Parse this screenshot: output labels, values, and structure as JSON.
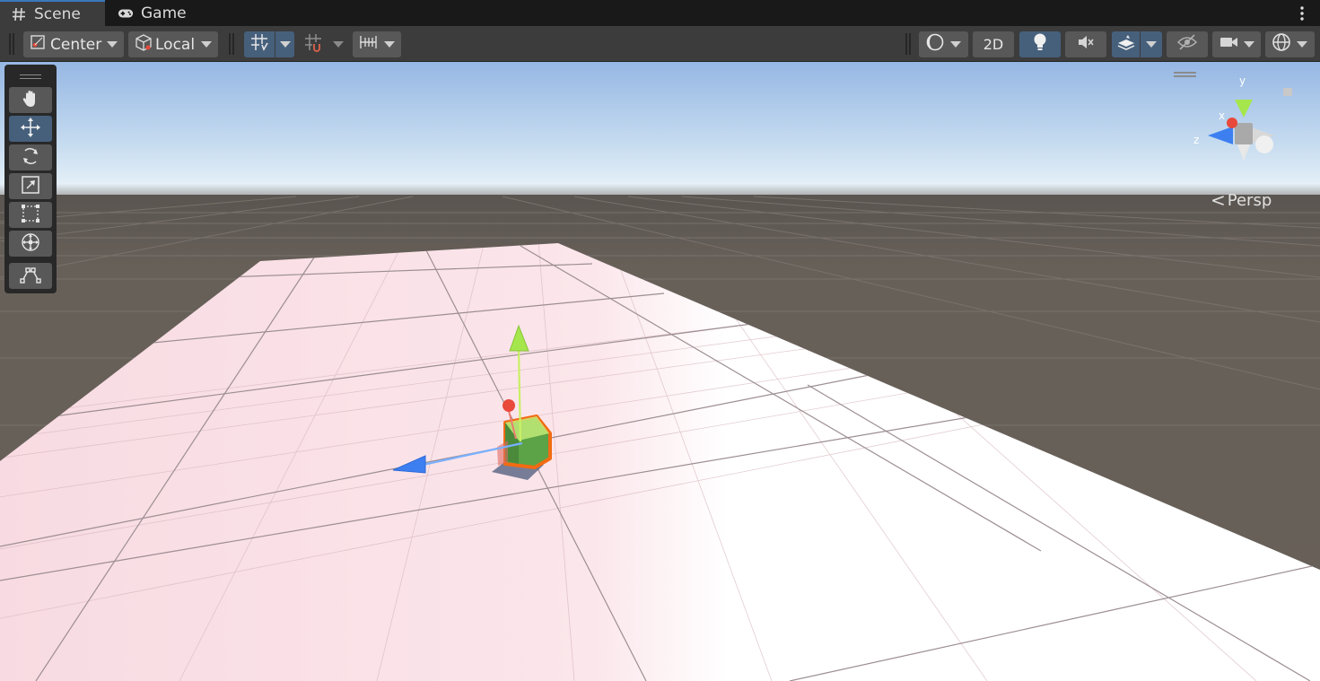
{
  "tabs": [
    {
      "label": "Scene",
      "icon": "hash-icon",
      "active": true
    },
    {
      "label": "Game",
      "icon": "gamepad-icon",
      "active": false
    }
  ],
  "toolbar": {
    "pivot_mode": "Center",
    "pivot_rotation": "Local",
    "mode_2d_label": "2D"
  },
  "tools": [
    {
      "name": "hand-tool",
      "icon": "hand-icon"
    },
    {
      "name": "move-tool",
      "icon": "move-icon",
      "active": true
    },
    {
      "name": "rotate-tool",
      "icon": "rotate-icon"
    },
    {
      "name": "scale-tool",
      "icon": "scale-icon"
    },
    {
      "name": "rect-tool",
      "icon": "rect-transform-icon"
    },
    {
      "name": "transform-tool",
      "icon": "transform-icon"
    },
    {
      "name": "custom-tool",
      "icon": "custom-tool-icon"
    }
  ],
  "gizmo": {
    "projection_label": "Persp",
    "axis_y": "y",
    "axis_x": "x",
    "axis_z": "z"
  },
  "colors": {
    "active_button": "#46607c",
    "accent_blue": "#3a79bb",
    "axis_x": "#e8493a",
    "axis_y": "#a5e64d",
    "axis_z": "#3d7ff0",
    "selection_outline": "#f26b12"
  }
}
